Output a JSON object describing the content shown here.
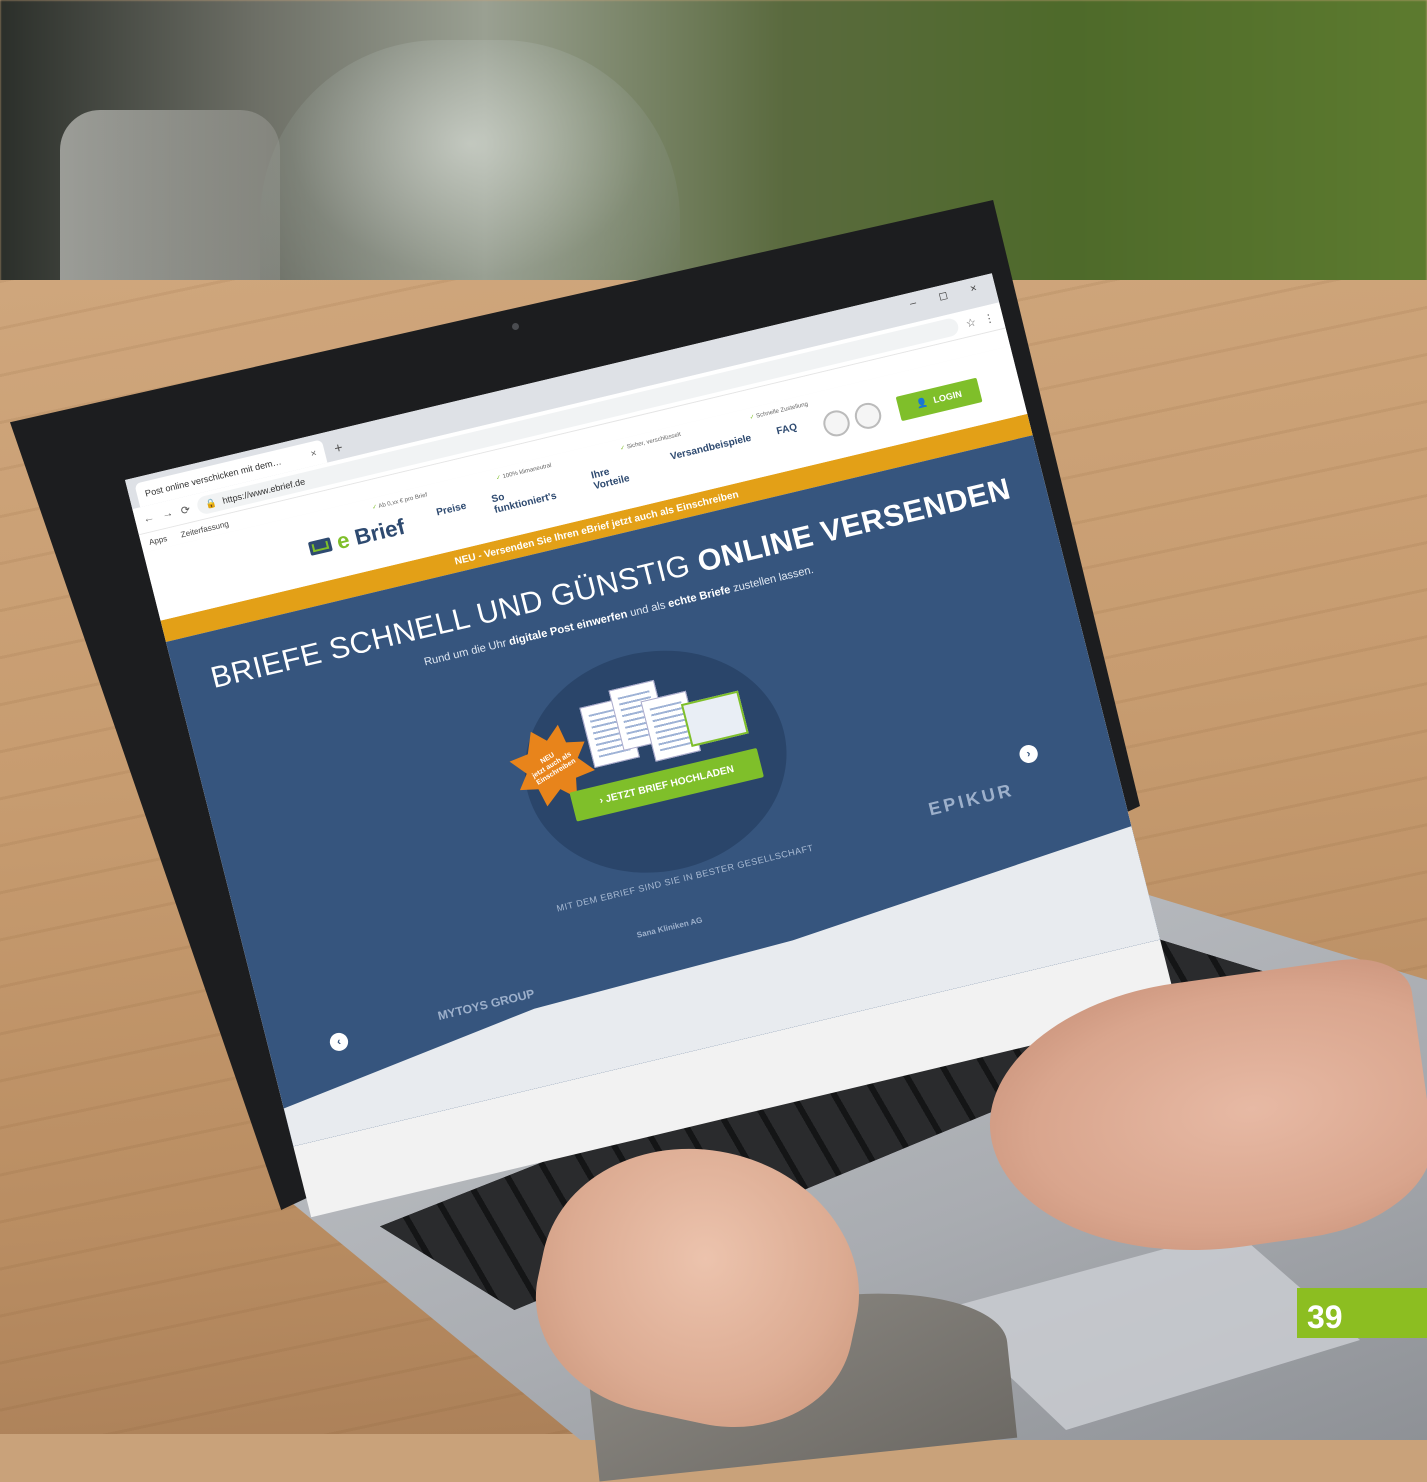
{
  "browser": {
    "tab_title": "Post online verschicken mit dem…",
    "tab_close": "×",
    "new_tab": "+",
    "window_controls": "– ◻ ×",
    "url": "https://www.ebrief.de",
    "bookmarks": [
      "Apps",
      "Zeiterfassung"
    ]
  },
  "header": {
    "logo_prefix": "e",
    "logo_suffix": "Brief",
    "nav": [
      "Preise",
      "So funktioniert's",
      "Ihre Vorteile",
      "Versandbeispiele",
      "FAQ"
    ],
    "checks": [
      "Ab 0,xx € pro Brief",
      "100% klimaneutral",
      "Sicher, verschlüsselt",
      "Schnelle Zustellung"
    ],
    "login_label": "LOGIN"
  },
  "banner": {
    "text": "NEU - Versenden Sie Ihren eBrief jetzt auch als Einschreiben"
  },
  "hero": {
    "title_prefix": "BRIEFE SCHNELL UND GÜNSTIG ",
    "title_bold": "ONLINE VERSENDEN",
    "sub_1": "Rund um die Uhr ",
    "sub_bold_1": "digitale Post einwerfen",
    "sub_2": " und als ",
    "sub_bold_2": "echte Briefe",
    "sub_3": " zustellen lassen.",
    "burst_1": "NEU",
    "burst_2": "jetzt auch als",
    "burst_3": "Einschreiben",
    "upload_label": "› JETZT BRIEF HOCHLADEN",
    "partners_label": "MIT DEM EBRIEF SIND SIE IN BESTER GESELLSCHAFT",
    "partner_1": "EPIKUR",
    "partner_2": "Sana Kliniken AG",
    "partner_3": "MYTOYS GROUP",
    "prev": "‹",
    "next": "›"
  },
  "page_number": "39",
  "colors": {
    "brand_blue": "#36557e",
    "brand_green": "#7fbf2a",
    "banner_orange": "#e3a017",
    "page_tab_green": "#8cbe21"
  }
}
